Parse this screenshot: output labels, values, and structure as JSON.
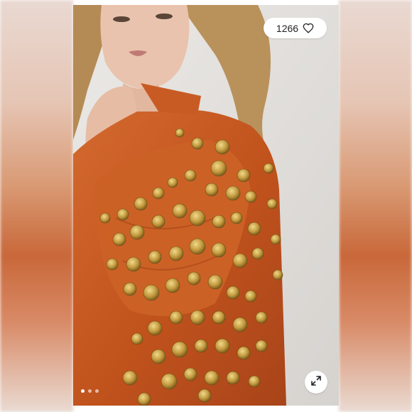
{
  "listing": {
    "like_count": "1266",
    "photos_total": 3,
    "active_photo_index": 1
  },
  "icons": {
    "like": "heart-icon",
    "expand": "expand-arrows-icon"
  },
  "colors": {
    "jacket": "#c4541f",
    "stud": "#c8a24a",
    "pill_bg": "#ffffff"
  }
}
